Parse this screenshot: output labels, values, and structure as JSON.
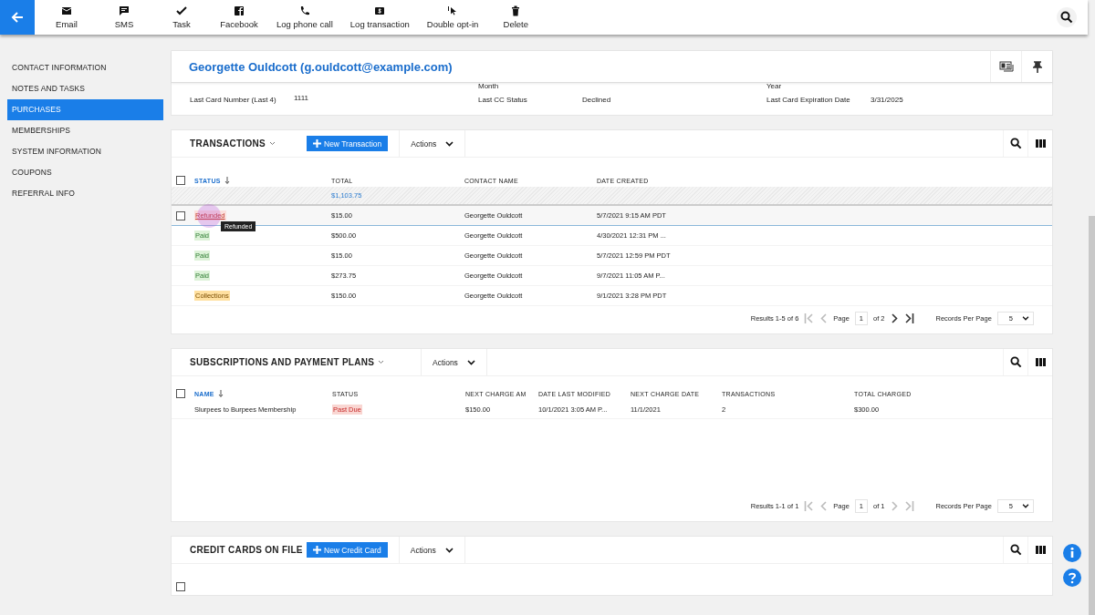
{
  "toolbar": {
    "actions": [
      "Email",
      "SMS",
      "Task",
      "Facebook",
      "Log phone call",
      "Log transaction",
      "Double opt-in",
      "Delete"
    ]
  },
  "sidebar": {
    "items": [
      {
        "label": "CONTACT INFORMATION",
        "selected": false
      },
      {
        "label": "NOTES AND TASKS",
        "selected": false
      },
      {
        "label": "PURCHASES",
        "selected": true
      },
      {
        "label": "MEMBERSHIPS",
        "selected": false
      },
      {
        "label": "SYSTEM INFORMATION",
        "selected": false
      },
      {
        "label": "COUPONS",
        "selected": false
      },
      {
        "label": "REFERRAL INFO",
        "selected": false
      }
    ]
  },
  "contact": {
    "title": "Georgette Ouldcott (g.ouldcott@example.com)",
    "cut_labels": [
      "Month",
      "Year"
    ],
    "fields": [
      {
        "label": "Last Card Number (Last 4)",
        "value": "1111"
      },
      {
        "label": "Last CC Status",
        "value": "Declined"
      },
      {
        "label": "Last Card Expiration Date",
        "value": "3/31/2025"
      }
    ]
  },
  "transactions": {
    "title": "TRANSACTIONS",
    "new_button": "New Transaction",
    "actions": "Actions",
    "columns": [
      {
        "label": "STATUS",
        "sorted": true
      },
      {
        "label": "TOTAL",
        "sorted": false
      },
      {
        "label": "CONTACT NAME",
        "sorted": false
      },
      {
        "label": "DATE CREATED",
        "sorted": false
      }
    ],
    "select_all_checked": false,
    "total": "$1,103.75",
    "rows": [
      {
        "status": "Refunded",
        "kind": "refunded",
        "total": "$15.00",
        "contact": "Georgette Ouldcott",
        "date": "5/7/2021 9:15 AM PDT",
        "hovered": true,
        "tooltip": "Refunded"
      },
      {
        "status": "Paid",
        "kind": "paid",
        "total": "$500.00",
        "contact": "Georgette Ouldcott",
        "date": "4/30/2021 12:31 PM ...",
        "hovered": false
      },
      {
        "status": "Paid",
        "kind": "paid",
        "total": "$15.00",
        "contact": "Georgette Ouldcott",
        "date": "5/7/2021 12:59 PM PDT",
        "hovered": false
      },
      {
        "status": "Paid",
        "kind": "paid",
        "total": "$273.75",
        "contact": "Georgette Ouldcott",
        "date": "9/7/2021 11:05 AM P...",
        "hovered": false
      },
      {
        "status": "Collections",
        "kind": "collections",
        "total": "$150.00",
        "contact": "Georgette Ouldcott",
        "date": "9/1/2021 3:28 PM PDT",
        "hovered": false
      }
    ],
    "pager": {
      "results": "Results 1-5 of 6",
      "page_label": "Page",
      "page": "1",
      "of": "of 2",
      "records_label": "Records Per Page",
      "per_page": "5",
      "back_disabled": true,
      "forward_disabled": false
    }
  },
  "subscriptions": {
    "title": "SUBSCRIPTIONS AND PAYMENT PLANS",
    "actions": "Actions",
    "columns": [
      {
        "label": "NAME",
        "sorted": true
      },
      {
        "label": "STATUS",
        "sorted": false
      },
      {
        "label": "NEXT CHARGE AM",
        "sorted": false
      },
      {
        "label": "DATE LAST MODIFIED",
        "sorted": false
      },
      {
        "label": "NEXT CHARGE DATE",
        "sorted": false
      },
      {
        "label": "TRANSACTIONS",
        "sorted": false
      },
      {
        "label": "TOTAL CHARGED",
        "sorted": false
      }
    ],
    "select_all_checked": false,
    "rows": [
      {
        "name": "Slurpees to Burpees Membership",
        "status": "Past Due",
        "kind": "past_due",
        "next_charge": "$150.00",
        "modified": "10/1/2021 3:05 AM P...",
        "next_date": "11/1/2021",
        "transactions": "2",
        "total": "$300.00"
      }
    ],
    "pager": {
      "results": "Results 1-1 of 1",
      "page_label": "Page",
      "page": "1",
      "of": "of 1",
      "records_label": "Records Per Page",
      "per_page": "5",
      "back_disabled": true,
      "forward_disabled": true
    }
  },
  "credit_cards": {
    "title": "CREDIT CARDS ON FILE",
    "new_button": "New Credit Card",
    "actions": "Actions",
    "select_all_checked": false
  }
}
